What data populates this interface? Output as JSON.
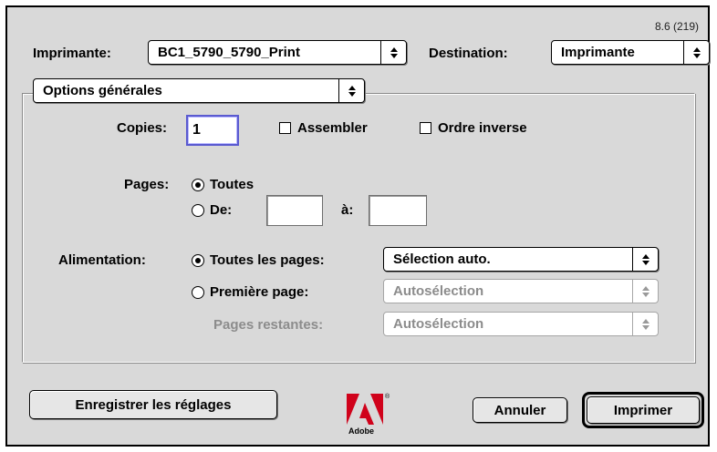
{
  "version": "8.6 (219)",
  "printer": {
    "label": "Imprimante:",
    "value": "BC1_5790_5790_Print"
  },
  "destination": {
    "label": "Destination:",
    "value": "Imprimante"
  },
  "panel": {
    "value": "Options générales"
  },
  "copies": {
    "label": "Copies:",
    "value": "1"
  },
  "collate": {
    "label": "Assembler",
    "checked": false
  },
  "reverse": {
    "label": "Ordre inverse",
    "checked": false
  },
  "pages": {
    "label": "Pages:",
    "all_label": "Toutes",
    "from_label": "De:",
    "to_label": "à:",
    "from_value": "",
    "to_value": "",
    "selected": "all"
  },
  "paper_source": {
    "label": "Alimentation:",
    "all_pages_label": "Toutes les pages:",
    "all_pages_value": "Sélection auto.",
    "first_page_label": "Première page:",
    "first_page_value": "Autosélection",
    "remaining_label": "Pages restantes:",
    "remaining_value": "Autosélection",
    "selected": "all_pages"
  },
  "buttons": {
    "save_settings": "Enregistrer les réglages",
    "cancel": "Annuler",
    "print": "Imprimer"
  },
  "logo": {
    "text": "Adobe",
    "reg": "®",
    "color": "#d0021b"
  },
  "icons": {
    "popup_arrows": "updown-arrows-icon",
    "logo": "adobe-logo-icon"
  }
}
